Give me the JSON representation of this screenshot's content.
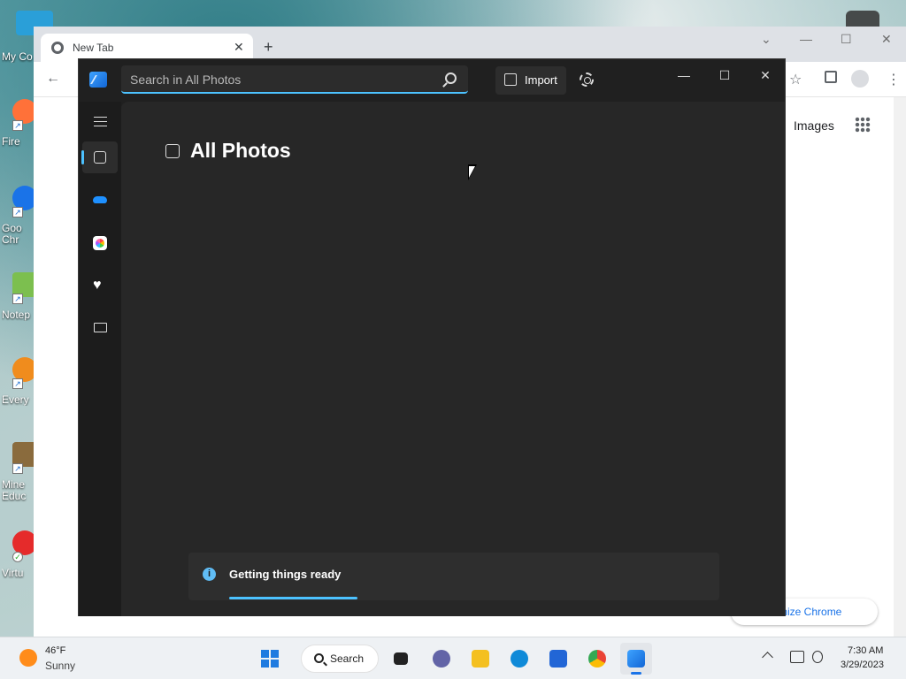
{
  "desktop": {
    "icons": [
      {
        "label": "My Co",
        "name": "this-pc",
        "color": "#2a9fd8"
      },
      {
        "label": "Fire",
        "name": "firefox",
        "color": "#ff7139"
      },
      {
        "label": "Goo\nChr",
        "name": "google-chrome",
        "color": "#1a73e8"
      },
      {
        "label": "Notep",
        "name": "notepad",
        "color": "#7cbf4f"
      },
      {
        "label": "Every",
        "name": "everything",
        "color": "#f08c1d"
      },
      {
        "label": "Mine\nEduc",
        "name": "minecraft-education",
        "color": "#8a6b3d"
      },
      {
        "label": "Virtu",
        "name": "virtual-app",
        "color": "#e52b2b"
      }
    ]
  },
  "chrome": {
    "tab_title": "New Tab",
    "tab_close": "✕",
    "new_tab": "+",
    "images_link": "Images",
    "customize_label": "tomize Chrome",
    "minimize": "—",
    "maximize": "☐",
    "close": "✕"
  },
  "photos": {
    "search_placeholder": "Search in All Photos",
    "import_label": "Import",
    "page_title": "All Photos",
    "minimize": "—",
    "maximize": "☐",
    "close": "✕",
    "nav": [
      {
        "name": "menu",
        "icon": "hamburger-icon"
      },
      {
        "name": "all-photos",
        "icon": "picture-icon",
        "active": true
      },
      {
        "name": "onedrive",
        "icon": "cloud-icon"
      },
      {
        "name": "icloud-photos",
        "icon": "icloud-icon"
      },
      {
        "name": "favorites",
        "icon": "heart-icon"
      },
      {
        "name": "folders",
        "icon": "folder-icon"
      }
    ],
    "toast": {
      "message": "Getting things ready",
      "info_glyph": "i",
      "progress": 0.25
    },
    "accent": "#4cc2ff"
  },
  "taskbar": {
    "weather_temp": "46°F",
    "weather_condition": "Sunny",
    "search_label": "Search",
    "time": "7:30 AM",
    "date": "3/29/2023",
    "apps": [
      {
        "name": "task-view",
        "color": "#222222"
      },
      {
        "name": "teams-chat",
        "color": "#6264a7"
      },
      {
        "name": "file-explorer",
        "color": "#f4c020"
      },
      {
        "name": "edge",
        "color": "#0f8ad8"
      },
      {
        "name": "microsoft-store",
        "color": "#2266d6"
      },
      {
        "name": "chrome",
        "color": "#34a853"
      },
      {
        "name": "photos",
        "color": "#1f7be0",
        "active": true
      }
    ]
  }
}
